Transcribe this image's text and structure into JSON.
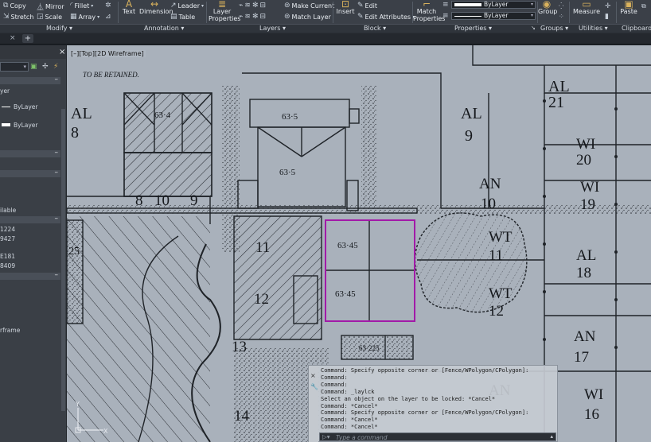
{
  "ribbon": {
    "modify": {
      "copy": "Copy",
      "mirror": "Mirror",
      "fillet": "Fillet",
      "stretch": "Stretch",
      "scale": "Scale",
      "array": "Array",
      "panel": "Modify"
    },
    "annotation": {
      "text": "Text",
      "dimension": "Dimension",
      "leader": "Leader",
      "table": "Table",
      "panel": "Annotation"
    },
    "layers": {
      "layer_properties": "Layer\nProperties",
      "make_current": "Make Current",
      "match_layer": "Match Layer",
      "panel": "Layers"
    },
    "block": {
      "insert": "Insert",
      "edit": "Edit",
      "edit_attributes": "Edit Attributes",
      "panel": "Block"
    },
    "properties": {
      "match_properties": "Match\nProperties",
      "lineweight": "ByLayer",
      "linetype": "ByLayer",
      "panel": "Properties"
    },
    "groups": {
      "group": "Group",
      "panel": "Groups"
    },
    "utilities": {
      "measure": "Measure",
      "panel": "Utilities"
    },
    "clipboard": {
      "paste": "Paste",
      "panel": "Clipboard"
    }
  },
  "tabs": {
    "close": "×",
    "add": "+"
  },
  "palette": {
    "close": "×",
    "texts": [
      "yer",
      "ByLayer",
      "ByLayer",
      "ilable",
      "1224",
      "9427",
      "E181",
      "8409",
      "rframe"
    ],
    "section_toggle": "–"
  },
  "viewport": {
    "label": "[–][Top][2D Wireframe]",
    "drawing_labels": {
      "be_retained": "TO BE RETAINED.",
      "al8": "AL\n8",
      "al9": "AL\n9",
      "al21": "AL\n21",
      "al18": "AL\n18",
      "wi20": "WI\n20",
      "wi19": "WI\n19",
      "wi16": "WI\n16",
      "an10": "AN\n10",
      "an17": "AN\n17",
      "an13": "AN",
      "wt11": "WT\n11",
      "wt12": "WT\n12",
      "r634": "63·4",
      "r635a": "63·5",
      "r635b": "63·5",
      "r6345a": "63·45",
      "r6345b": "63·45",
      "r63225": "63·225",
      "n8": "8",
      "n10": "10",
      "n9": "9",
      "n11": "11",
      "n12": "12",
      "n13": "13",
      "n14": "14",
      "n25": "25",
      "n13b": "13"
    }
  },
  "command": {
    "lines": [
      "Command: Specify opposite corner or [Fence/WPolygon/CPolygon]:",
      "Command:",
      "Command:",
      "Command: _laylck",
      "Select an object on the layer to be locked: *Cancel*",
      "Command: *Cancel*",
      "Command: Specify opposite corner or [Fence/WPolygon/CPolygon]:",
      "Command: *Cancel*",
      "Command: *Cancel*"
    ],
    "placeholder": "Type a command"
  },
  "colors": {
    "ribbon_bg": "#3b4048",
    "viewport_bg": "#a9b1bb",
    "selection": "#a21aa8",
    "accent": "#d9b25d"
  }
}
